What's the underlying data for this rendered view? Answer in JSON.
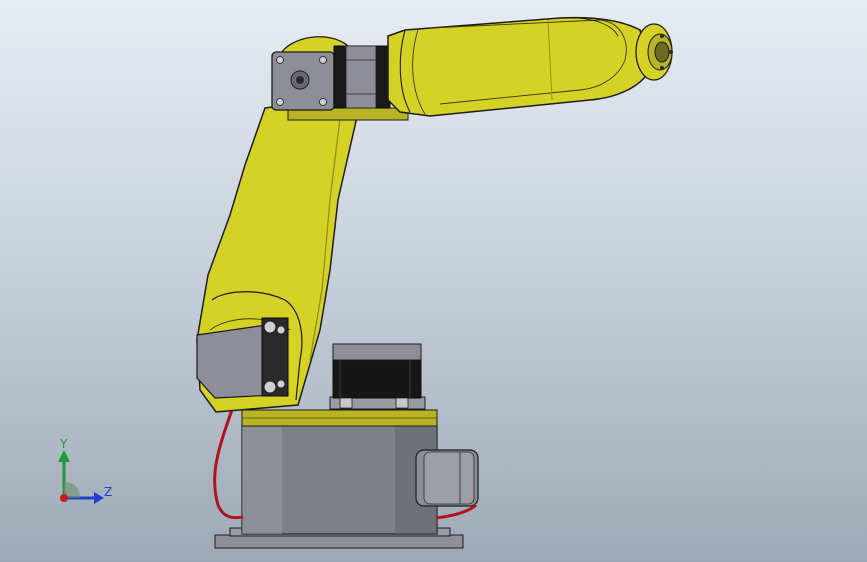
{
  "viewport": {
    "colors": {
      "arm_yellow": "#d4d224",
      "arm_shadow": "#a9a514",
      "motor_gray": "#8e8e98",
      "base_gray": "#7e8088",
      "motor_black": "#1a1a1a",
      "cable_red": "#b3121c",
      "outline": "#1c1c1c"
    }
  },
  "triad": {
    "y_label": "Y",
    "z_label": "Z",
    "colors": {
      "y": "#1f9a3a",
      "z": "#1f3fcf",
      "x": "#d01818"
    }
  }
}
